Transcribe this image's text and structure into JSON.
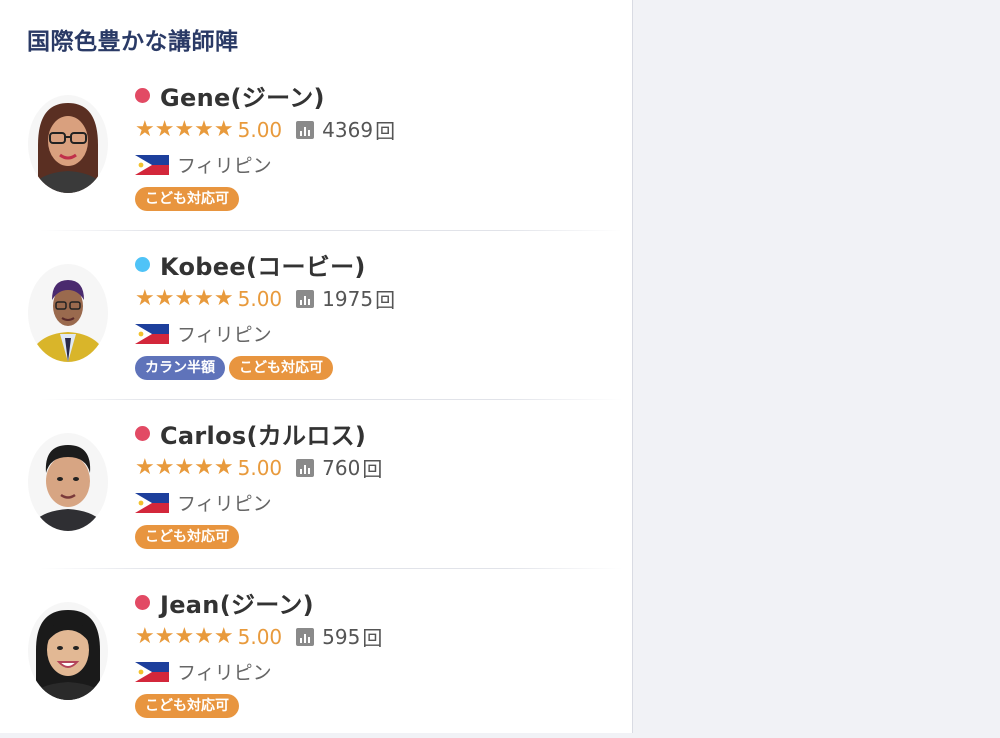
{
  "section": {
    "title": "国際色豊かな講師陣"
  },
  "colors": {
    "status_red": "#e24a64",
    "status_blue": "#4fc3f7",
    "star": "#e89a3c",
    "badge_orange": "#e8953f",
    "badge_blue": "#5f73ba"
  },
  "teachers": [
    {
      "name": "Gene(ジーン)",
      "status": "red",
      "stars": "★★★★★",
      "score": "5.00",
      "lessons": "4369",
      "lessons_unit": "回",
      "country": "フィリピン",
      "badges": [
        "こども対応可"
      ]
    },
    {
      "name": "Kobee(コービー)",
      "status": "blue",
      "stars": "★★★★★",
      "score": "5.00",
      "lessons": "1975",
      "lessons_unit": "回",
      "country": "フィリピン",
      "badges": [
        "カラン半額",
        "こども対応可"
      ]
    },
    {
      "name": "Carlos(カルロス)",
      "status": "red",
      "stars": "★★★★★",
      "score": "5.00",
      "lessons": "760",
      "lessons_unit": "回",
      "country": "フィリピン",
      "badges": [
        "こども対応可"
      ]
    },
    {
      "name": "Jean(ジーン)",
      "status": "red",
      "stars": "★★★★★",
      "score": "5.00",
      "lessons": "595",
      "lessons_unit": "回",
      "country": "フィリピン",
      "badges": [
        "こども対応可"
      ]
    }
  ]
}
